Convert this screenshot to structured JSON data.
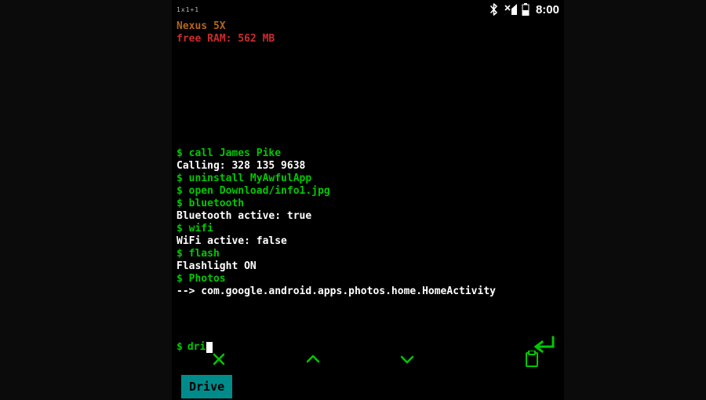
{
  "statusbar": {
    "carrier_text": "1x1+1",
    "clock": "8:00",
    "bluetooth_on": true,
    "signal_strength": "partial",
    "battery_level": "half"
  },
  "header": {
    "device_name": "Nexus 5X",
    "ram_label": "free RAM:",
    "ram_value": "562 MB"
  },
  "log": [
    {
      "type": "cmd",
      "text": "$ call James Pike"
    },
    {
      "type": "out",
      "text": "Calling: 328 135 9638"
    },
    {
      "type": "cmd",
      "text": "$ uninstall MyAwfulApp"
    },
    {
      "type": "cmd",
      "text": "$ open Download/info1.jpg"
    },
    {
      "type": "cmd",
      "text": "$ bluetooth"
    },
    {
      "type": "out",
      "text": "Bluetooth active: true"
    },
    {
      "type": "cmd",
      "text": "$ wifi"
    },
    {
      "type": "out",
      "text": "WiFi active: false"
    },
    {
      "type": "cmd",
      "text": "$ flash"
    },
    {
      "type": "out",
      "text": "Flashlight ON"
    },
    {
      "type": "cmd",
      "text": "$ Photos"
    },
    {
      "type": "out",
      "text": "--> com.google.android.apps.photos.home.HomeActivity"
    }
  ],
  "input": {
    "prompt": "$",
    "current": "dri"
  },
  "toolbar": {
    "close": "close",
    "up_primary": "up",
    "up_secondary": "up",
    "down": "down",
    "clipboard": "clipboard",
    "enter": "enter"
  },
  "suggestion": {
    "label": "Drive"
  }
}
